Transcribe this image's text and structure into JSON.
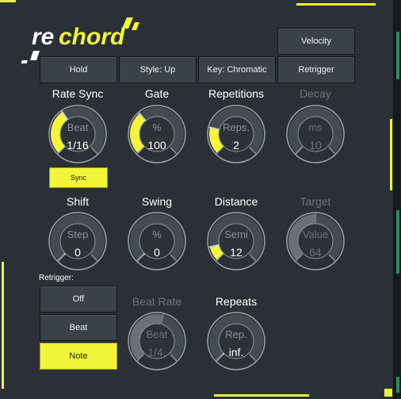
{
  "logo": "rechord",
  "buttons": {
    "hold": "Hold",
    "style": "Style: Up",
    "key": "Key: Chromatic",
    "velocity": "Velocity",
    "retrigger": "Retrigger",
    "sync": "Sync",
    "off": "Off",
    "beat": "Beat",
    "note": "Note"
  },
  "retrigger_label": "Retrigger:",
  "knobs": {
    "rate_sync": {
      "label": "Rate Sync",
      "unit": "Beat",
      "value": "1/16",
      "level": 0.37,
      "disabled": false
    },
    "gate": {
      "label": "Gate",
      "unit": "%",
      "value": "100",
      "level": 0.35,
      "disabled": false
    },
    "repetitions": {
      "label": "Repetitions",
      "unit": "Reps.",
      "value": "2",
      "level": 0.22,
      "disabled": false
    },
    "decay": {
      "label": "Decay",
      "unit": "ms",
      "value": "10",
      "level": 0.0,
      "disabled": true
    },
    "shift": {
      "label": "Shift",
      "unit": "Step",
      "value": "0",
      "level": 0.0,
      "disabled": false
    },
    "swing": {
      "label": "Swing",
      "unit": "%",
      "value": "0",
      "level": 0.0,
      "disabled": false
    },
    "distance": {
      "label": "Distance",
      "unit": "Semi",
      "value": "12",
      "level": 0.12,
      "disabled": false
    },
    "target": {
      "label": "Target",
      "unit": "Value",
      "value": "64",
      "level": 0.5,
      "disabled": true
    },
    "beat_rate": {
      "label": "Beat Rate",
      "unit": "Beat",
      "value": "1/4.",
      "level": 0.55,
      "disabled": true
    },
    "repeats": {
      "label": "Repeats",
      "unit": "Rep.",
      "value": "inf.",
      "level": 0.0,
      "disabled": false
    }
  },
  "colors": {
    "accent": "#f2f53a",
    "panel": "#2b3036",
    "button": "#3a4148",
    "track": "#5a6168",
    "ring": "#9aa1a7"
  }
}
